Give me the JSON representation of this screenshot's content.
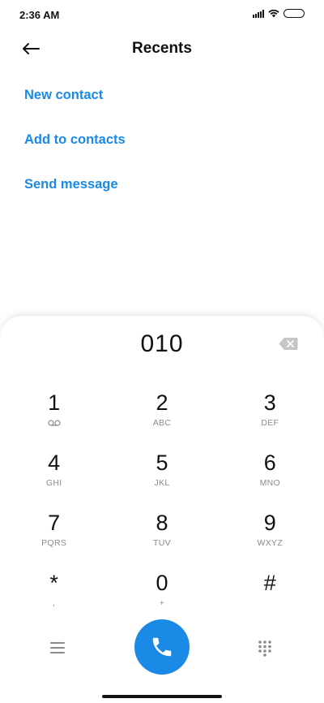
{
  "status_bar": {
    "time": "2:36 AM"
  },
  "header": {
    "title": "Recents"
  },
  "actions": [
    {
      "label": "New contact"
    },
    {
      "label": "Add to contacts"
    },
    {
      "label": "Send message"
    }
  ],
  "dialer": {
    "number": "010",
    "keys": [
      {
        "digit": "1",
        "letters": ""
      },
      {
        "digit": "2",
        "letters": "ABC"
      },
      {
        "digit": "3",
        "letters": "DEF"
      },
      {
        "digit": "4",
        "letters": "GHI"
      },
      {
        "digit": "5",
        "letters": "JKL"
      },
      {
        "digit": "6",
        "letters": "MNO"
      },
      {
        "digit": "7",
        "letters": "PQRS"
      },
      {
        "digit": "8",
        "letters": "TUV"
      },
      {
        "digit": "9",
        "letters": "WXYZ"
      },
      {
        "digit": "*",
        "letters": ","
      },
      {
        "digit": "0",
        "letters": "+"
      },
      {
        "digit": "#",
        "letters": ""
      }
    ]
  },
  "icons": {
    "back": "arrow-left-icon",
    "backspace": "backspace-icon",
    "voicemail": "voicemail-icon",
    "menu": "menu-icon",
    "call": "phone-icon",
    "dialpad": "dialpad-icon"
  },
  "colors": {
    "accent": "#1a8ae6",
    "text": "#111111",
    "secondary_text": "#8a8a8a"
  }
}
